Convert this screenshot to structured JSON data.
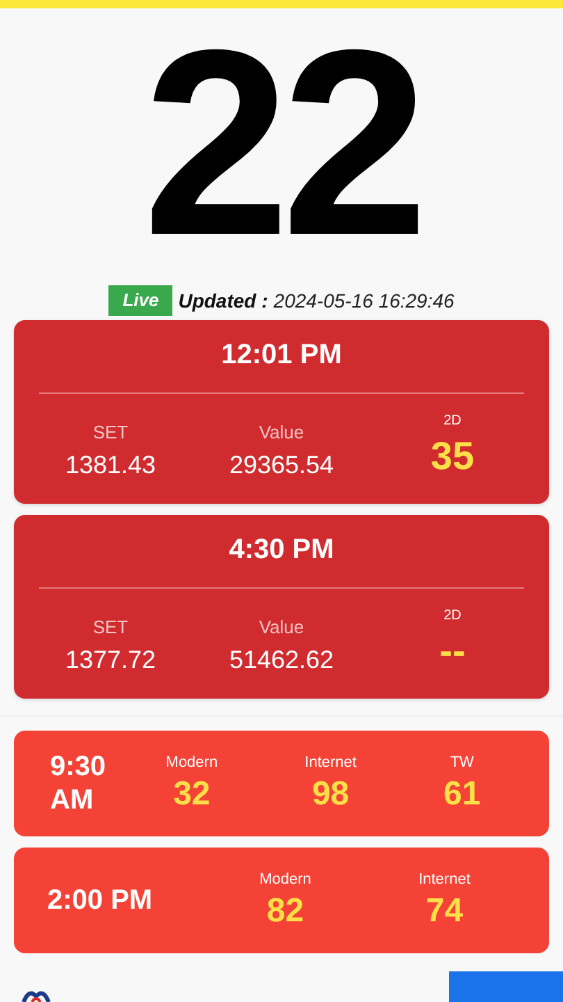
{
  "result": "22",
  "status": {
    "badge": "Live",
    "label": "Updated :",
    "time": "2024-05-16 16:29:46"
  },
  "draws": [
    {
      "time": "12:01 PM",
      "set_label": "SET",
      "set": "1381.43",
      "value_label": "Value",
      "value": "29365.54",
      "twod_label": "2D",
      "twod": "35"
    },
    {
      "time": "4:30 PM",
      "set_label": "SET",
      "set": "1377.72",
      "value_label": "Value",
      "value": "51462.62",
      "twod_label": "2D",
      "twod": "--"
    }
  ],
  "sessions": [
    {
      "time": "9:30 AM",
      "results": [
        {
          "label": "Modern",
          "value": "32"
        },
        {
          "label": "Internet",
          "value": "98"
        },
        {
          "label": "TW",
          "value": "61"
        }
      ]
    },
    {
      "time": "2:00 PM",
      "results": [
        {
          "label": "Modern",
          "value": "82"
        },
        {
          "label": "Internet",
          "value": "74"
        }
      ]
    }
  ]
}
